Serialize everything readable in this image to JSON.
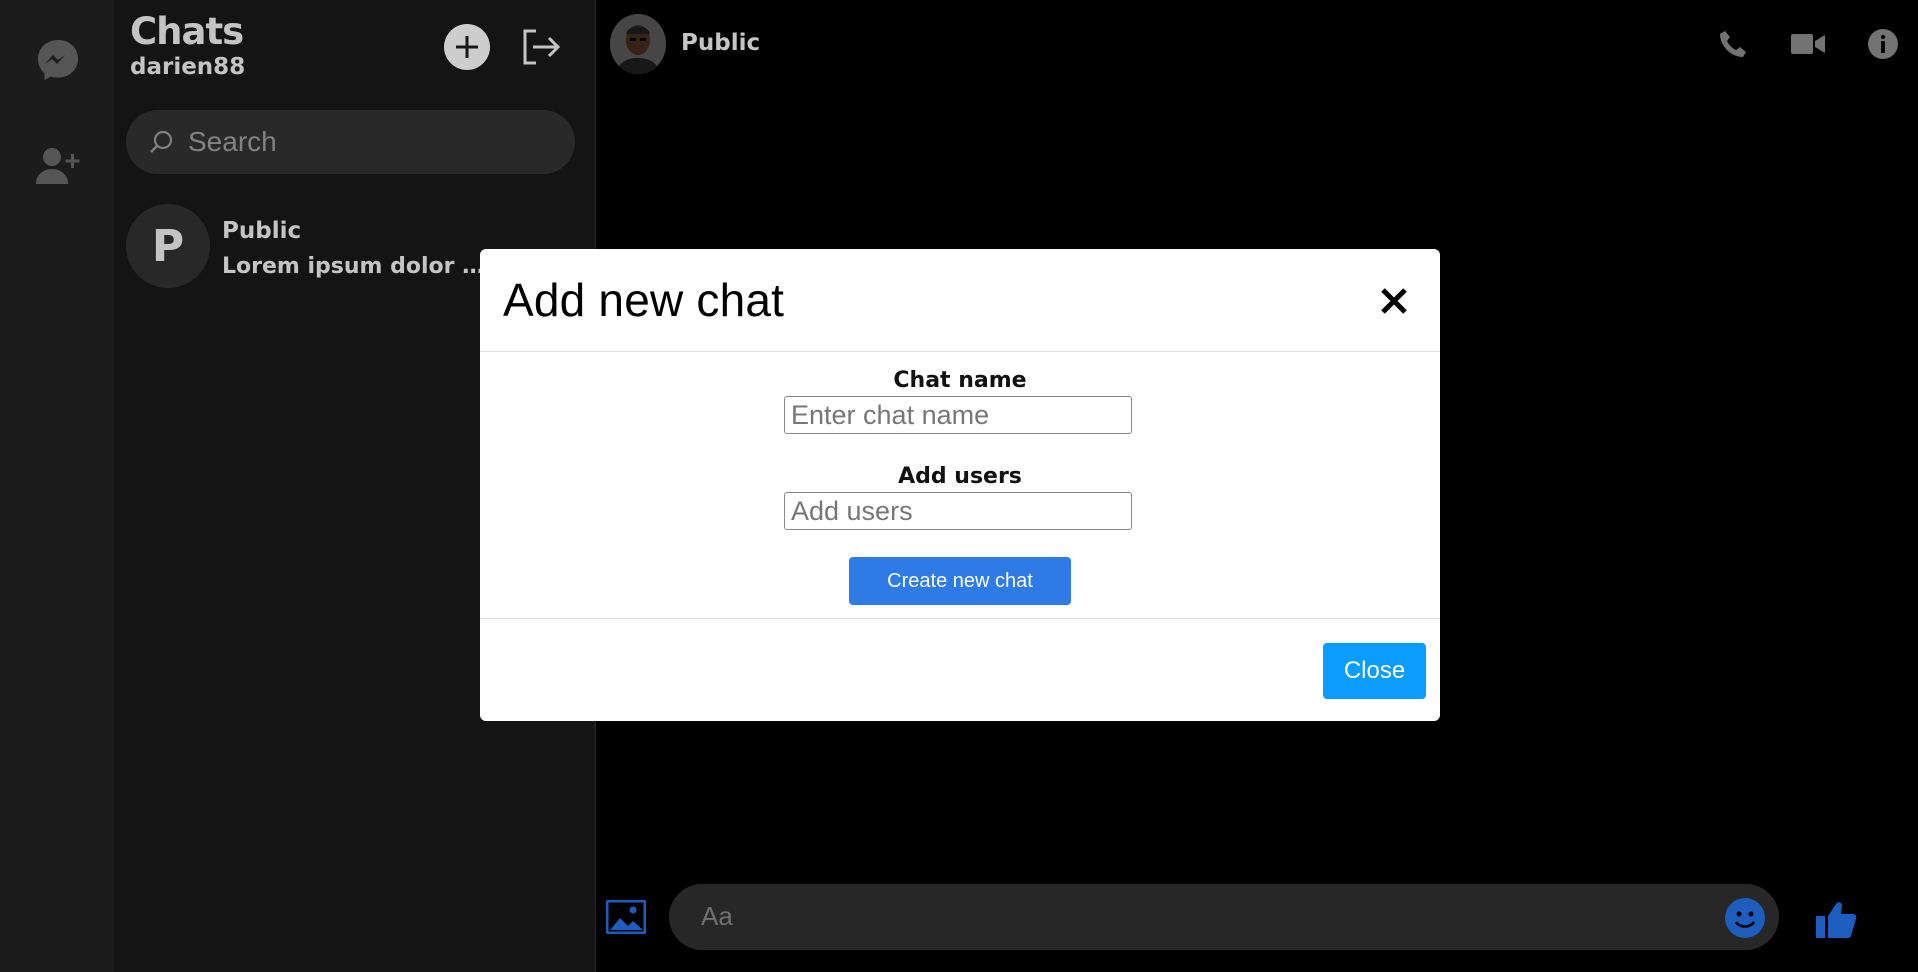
{
  "sidebar": {
    "title": "Chats",
    "username": "darien88",
    "search_placeholder": "Search",
    "chats": [
      {
        "avatar_letter": "P",
        "name": "Public",
        "preview": "Lorem ipsum dolor sit amet, consectetur"
      }
    ]
  },
  "header": {
    "chat_name": "Public"
  },
  "composer": {
    "placeholder": "Aa"
  },
  "modal": {
    "title": "Add new chat",
    "chat_name_label": "Chat name",
    "chat_name_placeholder": "Enter chat name",
    "users_label": "Add users",
    "users_placeholder": "Add users",
    "create_button": "Create new chat",
    "close_button": "Close"
  },
  "colors": {
    "accent_blue": "#2f7be5",
    "close_blue": "#0a9dff",
    "icon_blue": "#1e63c9"
  }
}
